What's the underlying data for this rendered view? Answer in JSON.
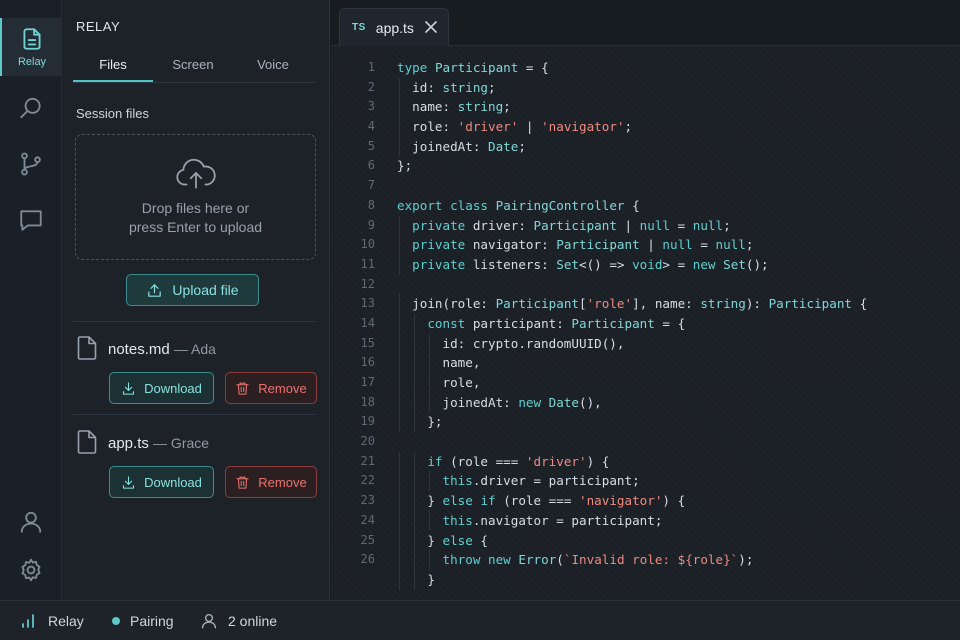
{
  "activity": {
    "items": [
      {
        "name": "relay",
        "label": "Relay",
        "icon": "file-icon",
        "active": true
      },
      {
        "name": "search",
        "icon": "search-icon"
      },
      {
        "name": "source-control",
        "icon": "git-branch-icon"
      },
      {
        "name": "chat",
        "icon": "chat-icon"
      },
      {
        "name": "account",
        "icon": "user-icon"
      },
      {
        "name": "settings",
        "icon": "gear-icon"
      }
    ]
  },
  "sidebar": {
    "title": "RELAY",
    "tabs": [
      "Files",
      "Screen",
      "Voice"
    ],
    "active_tab": "Files",
    "section_label": "Session files",
    "dropzone": {
      "line1": "Drop files here or",
      "line2": "press Enter to upload"
    },
    "upload_label": "Upload file",
    "files": [
      {
        "name": "notes.md",
        "owner": "— Ada",
        "download_label": "Download",
        "remove_label": "Remove"
      },
      {
        "name": "app.ts",
        "owner": "— Grace",
        "download_label": "Download",
        "remove_label": "Remove"
      }
    ]
  },
  "editor": {
    "tab": {
      "badge": "TS",
      "name": "app.ts"
    },
    "lines": [
      "type Participant = {",
      "  id: string;",
      "  name: string;",
      "  role: 'driver' | 'navigator';",
      "  joinedAt: Date;",
      "};",
      "",
      "export class PairingController {",
      "  private driver: Participant | null = null;",
      "  private navigator: Participant | null = null;",
      "  private listeners: Set<() => void> = new Set();",
      "",
      "  join(role: Participant['role'], name: string): Participant {",
      "    const participant: Participant = {",
      "      id: crypto.randomUUID(),",
      "      name,",
      "      role,",
      "      joinedAt: new Date(),",
      "    };",
      "",
      "    if (role === 'driver') {",
      "      this.driver = participant;",
      "    } else if (role === 'navigator') {",
      "      this.navigator = participant;",
      "    } else {",
      "      throw new Error(`Invalid role: ${role}`);",
      "    }"
    ],
    "line_numbers": [
      "1",
      "2",
      "3",
      "4",
      "5",
      "6",
      "7",
      "8",
      "9",
      "10",
      "11",
      "12",
      "13",
      "14",
      "15",
      "16",
      "17",
      "18",
      "19",
      "20",
      "21",
      "22",
      "23",
      "24",
      "25",
      "26",
      ""
    ]
  },
  "status": {
    "app": "Relay",
    "mode": "Pairing",
    "presence": "2 online"
  },
  "colors": {
    "accent": "#5ec8c8",
    "danger": "#e9736f",
    "string": "#ee8a7f",
    "background": "#161b20"
  }
}
